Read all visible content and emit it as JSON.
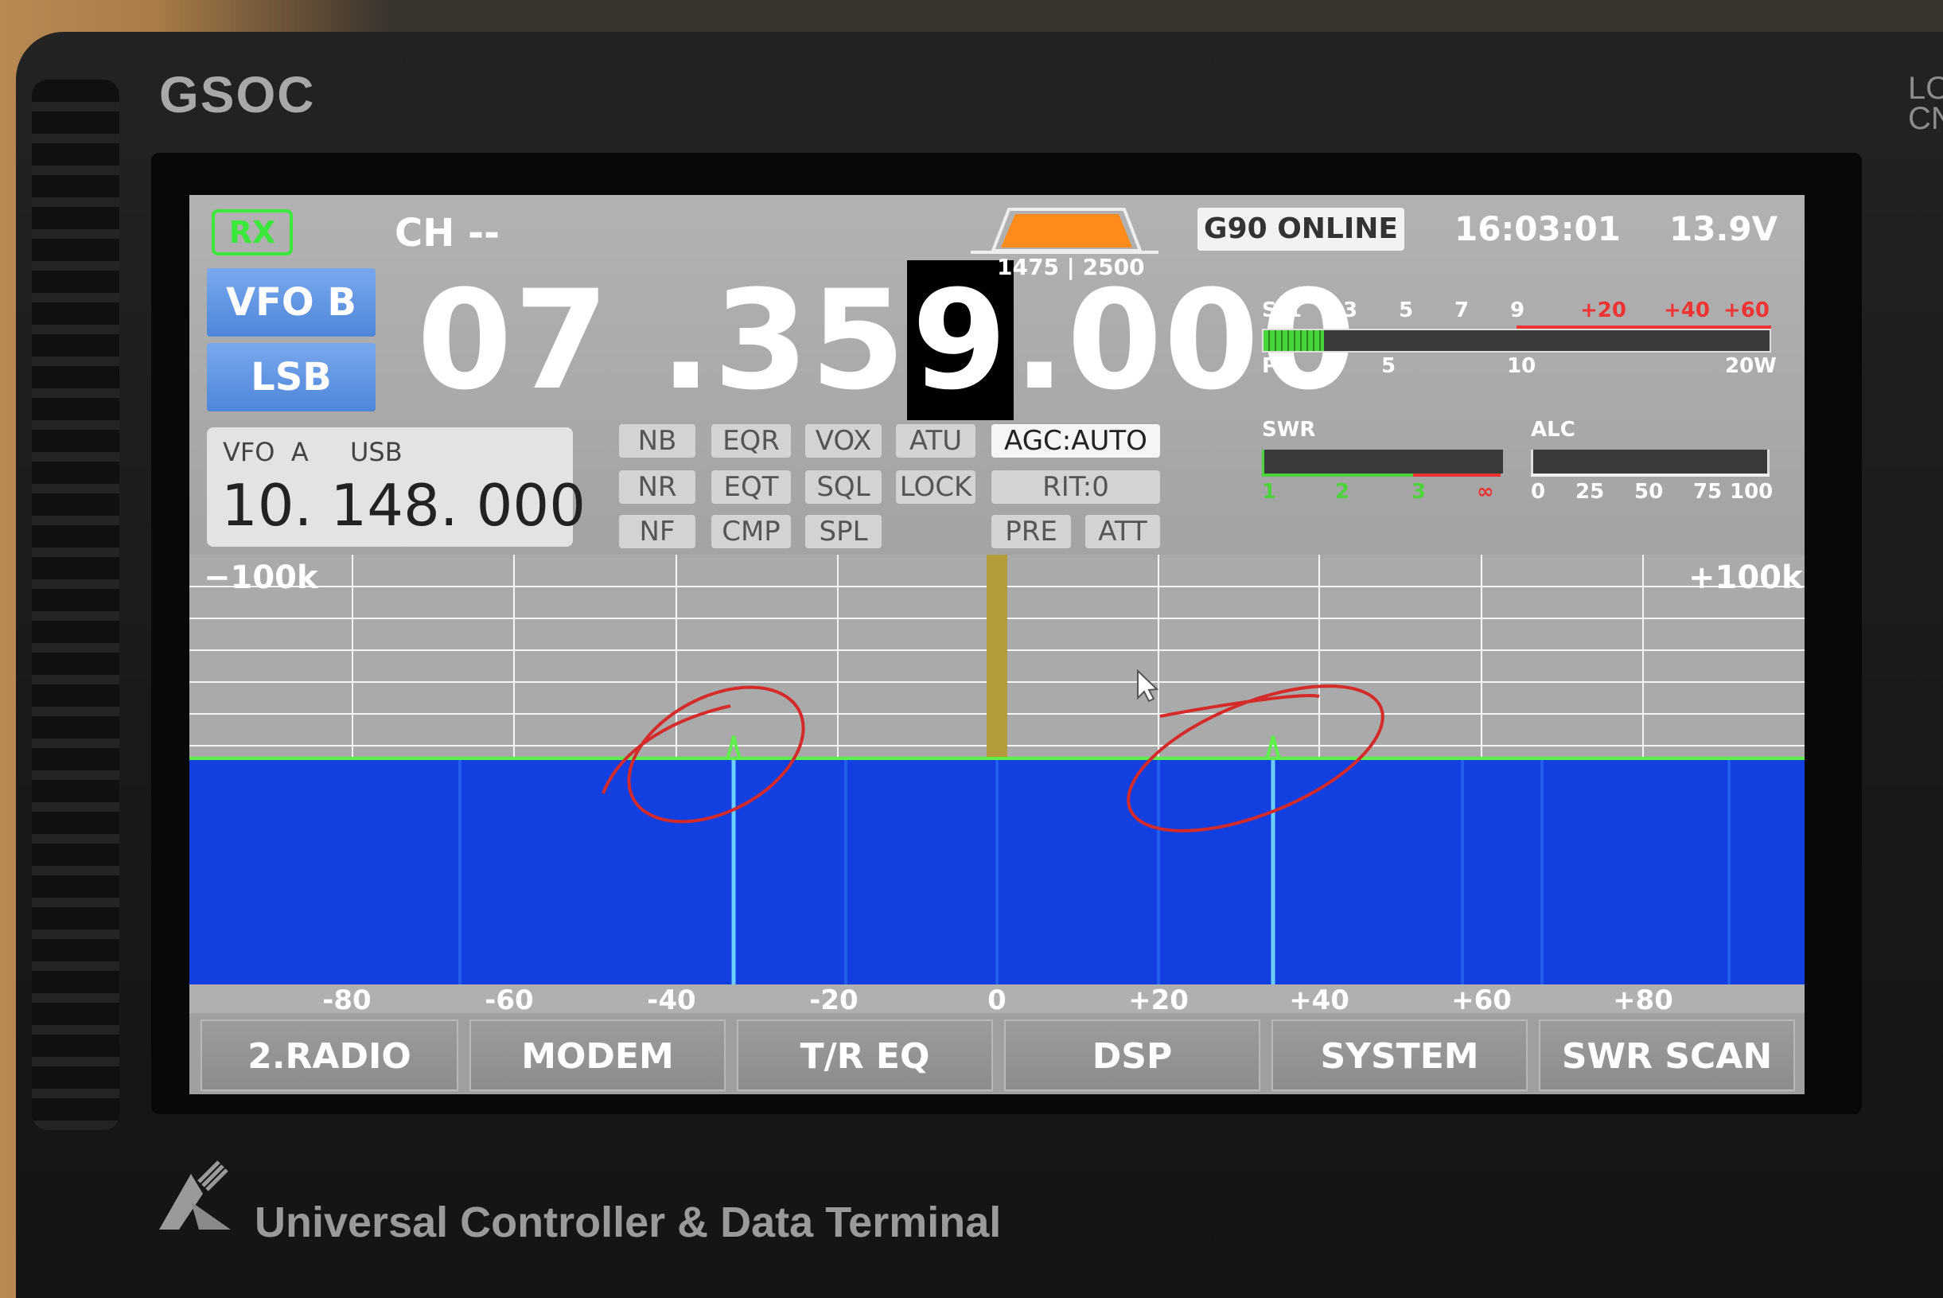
{
  "device": {
    "brand": "GSOC",
    "corner_text": "LO\nCN",
    "bottom_title": "Universal Controller & Data Terminal"
  },
  "status": {
    "rx": "RX",
    "channel": "CH --",
    "online": "G90 ONLINE",
    "time": "16:03:01",
    "voltage": "13.9V",
    "bandwidth_low": "1475",
    "bandwidth_high": "2500"
  },
  "vfo": {
    "active": "VFO B",
    "mode": "LSB",
    "freq_main_a": "07 .35",
    "freq_cursor": "9",
    "freq_main_b": ".000",
    "alt_label": "VFO  A",
    "alt_mode": "USB",
    "alt_freq": "10. 148. 000"
  },
  "functions": [
    {
      "label": "NB",
      "active": false
    },
    {
      "label": "EQR",
      "active": false
    },
    {
      "label": "VOX",
      "active": false
    },
    {
      "label": "ATU",
      "active": false
    },
    {
      "label": "AGC:AUTO",
      "active": true
    },
    {
      "label": "NR",
      "active": false
    },
    {
      "label": "EQT",
      "active": false
    },
    {
      "label": "SQL",
      "active": false
    },
    {
      "label": "LOCK",
      "active": false
    },
    {
      "label": "RIT:0",
      "active": false
    },
    {
      "label": "NF",
      "active": false
    },
    {
      "label": "CMP",
      "active": false
    },
    {
      "label": "SPL",
      "active": false
    },
    {
      "label": "PRE",
      "active": false
    },
    {
      "label": "ATT",
      "active": false
    }
  ],
  "meters": {
    "s_scale": [
      "S",
      "1",
      "3",
      "5",
      "7",
      "9",
      "+20",
      "+40",
      "+60"
    ],
    "po_scale": [
      "Po",
      "5",
      "10",
      "20W"
    ],
    "s_level": 0.12,
    "swr_label": "SWR",
    "swr_scale": [
      "1",
      "2",
      "3",
      "∞"
    ],
    "alc_label": "ALC",
    "alc_scale": [
      "0",
      "25",
      "50",
      "75",
      "100"
    ]
  },
  "spectrum": {
    "left_span": "−100k",
    "right_span": "+100k",
    "scale": [
      "-80",
      "-60",
      "-40",
      "-20",
      "0",
      "+20",
      "+40",
      "+60",
      "+80"
    ],
    "signals_khz": [
      -33,
      34
    ]
  },
  "tabs": [
    "2.RADIO",
    "MODEM",
    "T/R EQ",
    "DSP",
    "SYSTEM",
    "SWR SCAN"
  ],
  "colors": {
    "rx_green": "#39e83a",
    "vfo_blue": "#5a8fe0",
    "waterfall_blue": "#1240e0",
    "marker_gold": "#b39b3a",
    "annotation_red": "#d42a2a"
  }
}
